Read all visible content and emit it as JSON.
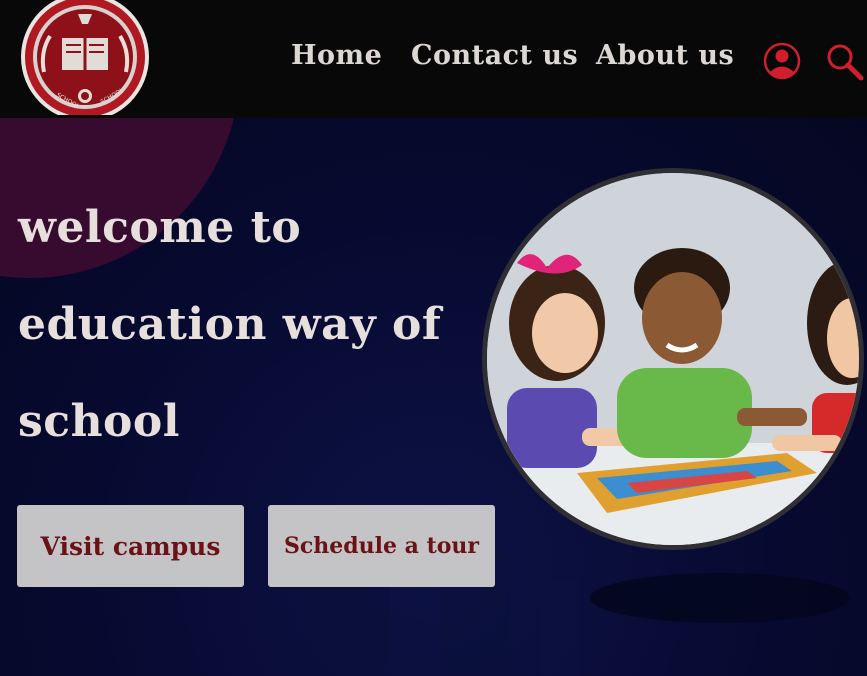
{
  "logo": {
    "ribbon_left": "SCHOOL",
    "ribbon_right": "SCHOOL"
  },
  "nav": {
    "home": "Home",
    "contact": "Contact us",
    "about": "About us"
  },
  "icons": {
    "user": "user-icon",
    "search": "search-icon"
  },
  "hero": {
    "line1": "welcome to",
    "line2": "education way of",
    "line3": "school"
  },
  "buttons": {
    "visit": "Visit campus",
    "tour": "Schedule a tour"
  },
  "colors": {
    "header_bg": "#080808",
    "hero_bg": "#070a30",
    "accent_red": "#d01f2a",
    "button_bg": "#c4c4c7",
    "button_text": "#6b1216",
    "heading_text": "#e6dfdb"
  }
}
